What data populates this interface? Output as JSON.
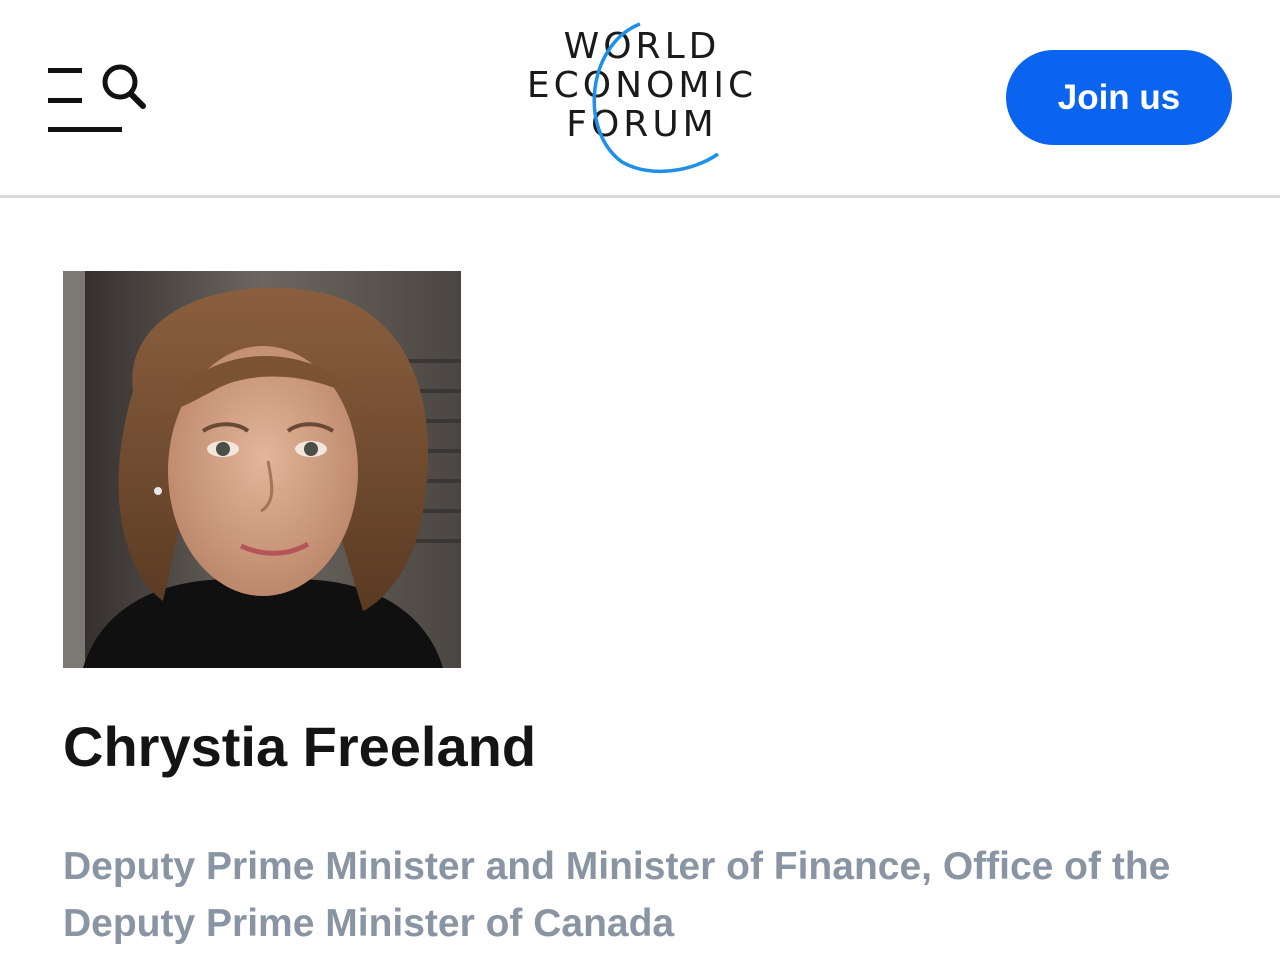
{
  "header": {
    "logo": {
      "line1": "WORLD",
      "line2": "ECONOMIC",
      "line3": "FORUM",
      "accent_color": "#1e90e8"
    },
    "menu_icon": "hamburger-menu-icon",
    "search_icon": "search-icon",
    "join_label": "Join us",
    "join_color": "#0a64f0"
  },
  "profile": {
    "photo_alt": "Chrystia Freeland",
    "name": "Chrystia Freeland",
    "role": "Deputy Prime Minister and Minister of Finance, Office of the Deputy Prime Minister of Canada"
  }
}
